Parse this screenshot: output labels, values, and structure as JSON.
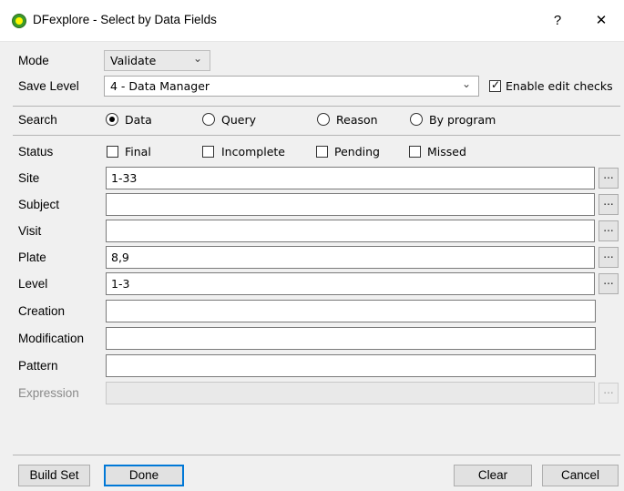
{
  "window": {
    "title": "DFexplore - Select by Data Fields",
    "help": "?",
    "close": "✕"
  },
  "mode": {
    "label": "Mode",
    "value": "Validate"
  },
  "save_level": {
    "label": "Save Level",
    "value": "4 - Data Manager"
  },
  "edit_checks": {
    "label": "Enable edit checks",
    "checked": true
  },
  "search": {
    "label": "Search",
    "options": [
      "Data",
      "Query",
      "Reason",
      "By program"
    ],
    "selected": "Data"
  },
  "status": {
    "label": "Status",
    "options": [
      "Final",
      "Incomplete",
      "Pending",
      "Missed"
    ]
  },
  "fields": [
    {
      "label": "Site",
      "value": "1-33"
    },
    {
      "label": "Subject",
      "value": ""
    },
    {
      "label": "Visit",
      "value": ""
    },
    {
      "label": "Plate",
      "value": "8,9"
    },
    {
      "label": "Level",
      "value": "1-3"
    },
    {
      "label": "Creation",
      "value": ""
    },
    {
      "label": "Modification",
      "value": ""
    },
    {
      "label": "Pattern",
      "value": ""
    },
    {
      "label": "Expression",
      "value": ""
    }
  ],
  "ellipsis": "...",
  "buttons": {
    "build_set": "Build Set",
    "done": "Done",
    "clear": "Clear",
    "cancel": "Cancel"
  }
}
